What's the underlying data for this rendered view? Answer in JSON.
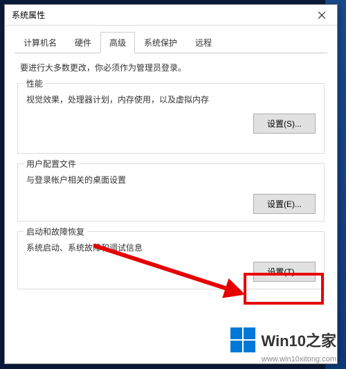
{
  "window": {
    "title": "系统属性"
  },
  "tabs": {
    "items": [
      {
        "label": "计算机名"
      },
      {
        "label": "硬件"
      },
      {
        "label": "高级",
        "active": true
      },
      {
        "label": "系统保护"
      },
      {
        "label": "远程"
      }
    ]
  },
  "admin_note": "要进行大多数更改，你必须作为管理员登录。",
  "groups": {
    "performance": {
      "title": "性能",
      "desc": "视觉效果，处理器计划，内存使用，以及虚拟内存",
      "button": "设置(S)..."
    },
    "user_profile": {
      "title": "用户配置文件",
      "desc": "与登录帐户相关的桌面设置",
      "button": "设置(E)..."
    },
    "startup": {
      "title": "启动和故障恢复",
      "desc": "系统启动、系统故障和调试信息",
      "button": "设置(T)..."
    }
  },
  "watermark": {
    "brand": "Win10之家",
    "url": "www.win10xitong.com"
  },
  "colors": {
    "highlight": "#e60000",
    "windows_blue": "#0078d7"
  }
}
